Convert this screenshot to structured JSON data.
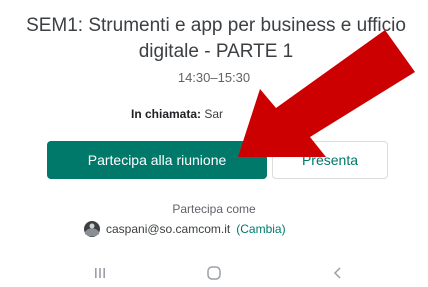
{
  "meeting": {
    "title": "SEM1: Strumenti e app per business e ufficio digitale - PARTE 1",
    "time": "14:30–15:30",
    "in_call_label": "In chiamata:",
    "in_call_names": "Sar"
  },
  "actions": {
    "join_label": "Partecipa alla riunione",
    "present_label": "Presenta"
  },
  "account": {
    "join_as_label": "Partecipa come",
    "email": "caspani@so.camcom.it",
    "change_label": "(Cambia)"
  },
  "icons": {
    "avatar": "avatar-icon",
    "recents": "recents-icon",
    "home": "home-icon",
    "back": "back-icon",
    "annotation": "red-arrow-icon"
  },
  "colors": {
    "accent": "#00796b",
    "annotation_arrow": "#cc0000"
  }
}
